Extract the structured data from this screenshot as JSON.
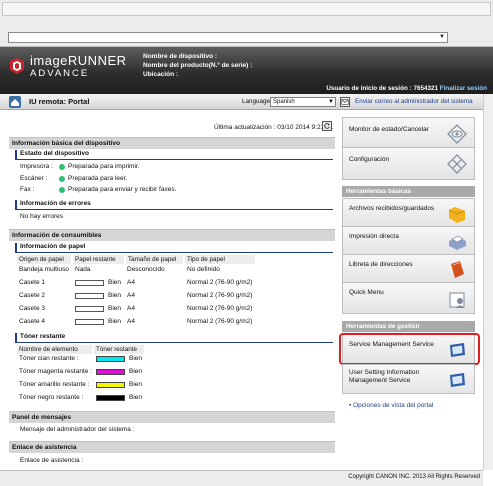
{
  "banner": {
    "logo_line1": "imageRUNNER",
    "logo_line2": "ADVANCE",
    "device_name_label": "Nombre de dispositivo :",
    "product_name_label": "Nombre del producto(N.º de serie) :",
    "location_label": "Ubicación :",
    "user_prefix": "Usuario de inicio de sesión : 7654321",
    "logout": "Finalizar sesión"
  },
  "titlebar": {
    "title": "IU remota: Portal",
    "language_label": "Language:",
    "language_value": "Spanish",
    "mail_link": "Enviar correo al administrador del sistema"
  },
  "main": {
    "last_update": "Última actualización : 03/10 2014 9:21:31",
    "basic_info_title": "Información básica del dispositivo",
    "device_status_title": "Estado del dispositivo",
    "status_rows": [
      {
        "label": "Impresora :",
        "value": "Preparada para imprimir."
      },
      {
        "label": "Escáner :",
        "value": "Preparada para leer."
      },
      {
        "label": "Fax :",
        "value": "Preparada para enviar y recibir faxes."
      }
    ],
    "error_title": "Información de errores",
    "error_text": "No hay errores",
    "consumables_title": "Información de consumibles",
    "paper_title": "Información de papel",
    "paper_headers": [
      "Origen de papel",
      "Papel restante",
      "Tamaño de papel",
      "Tipo de papel"
    ],
    "paper_rows": [
      {
        "source": "Bandeja multiuso",
        "remaining": "Nada",
        "size": "Desconocido",
        "type": "No definido"
      },
      {
        "source": "Casete 1",
        "remaining": "Bien",
        "size": "A4",
        "type": "Normal 2 (76-90 g/m2)"
      },
      {
        "source": "Casete 2",
        "remaining": "Bien",
        "size": "A4",
        "type": "Normal 2 (76-90 g/m2)"
      },
      {
        "source": "Casete 3",
        "remaining": "Bien",
        "size": "A4",
        "type": "Normal 2 (76-90 g/m2)"
      },
      {
        "source": "Casete 4",
        "remaining": "Bien",
        "size": "A4",
        "type": "Normal 2 (76-90 g/m2)"
      }
    ],
    "toner_title": "Tóner restante",
    "toner_headers": [
      "Nombre de elemento",
      "Tóner restante"
    ],
    "toner_rows": [
      {
        "name": "Tóner cian restante :",
        "value": "Bien",
        "color": "#00e5f0"
      },
      {
        "name": "Tóner magenta restante :",
        "value": "Bien",
        "color": "#e010d8"
      },
      {
        "name": "Tóner amarillo restante :",
        "value": "Bien",
        "color": "#f5f500"
      },
      {
        "name": "Tóner negro restante :",
        "value": "Bien",
        "color": "#000000"
      }
    ],
    "messages_title": "Panel de mensajes",
    "messages_text": "Mensaje del administrador del sistema :",
    "support_title": "Enlace de asistencia",
    "support_text": "Enlace de asistencia :"
  },
  "right": {
    "monitor": "Monitor de estado/Cancelar",
    "settings": "Configuración",
    "basic_tools_title": "Herramientas básicas",
    "received_files": "Archivos recibidos/guardados",
    "direct_print": "Impresión directa",
    "address_book": "Libreta de direcciones",
    "quick_menu": "Quick Menu",
    "mgmt_tools_title": "Herramientas de gestión",
    "service_mgmt": "Service Management Service",
    "user_settings_1": "User Setting Information",
    "user_settings_2": "Management Service",
    "view_options": "Opciones de vista del portal"
  },
  "footer": {
    "copyright": "Copyright CANON INC. 2013 All Rights Reserved"
  }
}
